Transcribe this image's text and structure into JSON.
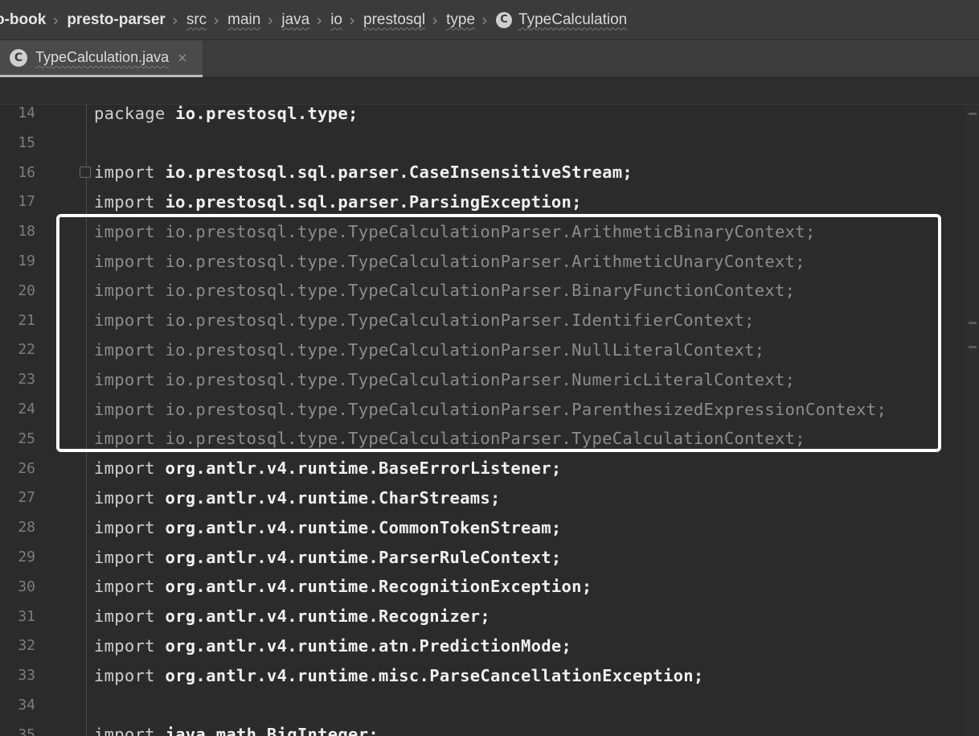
{
  "breadcrumb": {
    "items": [
      {
        "label": "o-book",
        "bold": true
      },
      {
        "label": "presto-parser",
        "bold": true
      },
      {
        "label": "src"
      },
      {
        "label": "main"
      },
      {
        "label": "java"
      },
      {
        "label": "io"
      },
      {
        "label": "prestosql"
      },
      {
        "label": "type"
      },
      {
        "label": "TypeCalculation",
        "icon": "class-icon"
      }
    ]
  },
  "tab": {
    "label": "TypeCalculation.java",
    "icon": "class-icon",
    "close_icon": "×"
  },
  "editor": {
    "lines": [
      {
        "num": "14",
        "kw": "package",
        "rest": " io.prestosql.type;",
        "unused": false
      },
      {
        "num": "15",
        "kw": "",
        "rest": "",
        "unused": false
      },
      {
        "num": "16",
        "kw": "import",
        "rest": " io.prestosql.sql.parser.CaseInsensitiveStream;",
        "unused": false,
        "fold": true
      },
      {
        "num": "17",
        "kw": "import",
        "rest": " io.prestosql.sql.parser.ParsingException;",
        "unused": false
      },
      {
        "num": "18",
        "kw": "import",
        "rest": " io.prestosql.type.TypeCalculationParser.ArithmeticBinaryContext;",
        "unused": true
      },
      {
        "num": "19",
        "kw": "import",
        "rest": " io.prestosql.type.TypeCalculationParser.ArithmeticUnaryContext;",
        "unused": true
      },
      {
        "num": "20",
        "kw": "import",
        "rest": " io.prestosql.type.TypeCalculationParser.BinaryFunctionContext;",
        "unused": true
      },
      {
        "num": "21",
        "kw": "import",
        "rest": " io.prestosql.type.TypeCalculationParser.IdentifierContext;",
        "unused": true
      },
      {
        "num": "22",
        "kw": "import",
        "rest": " io.prestosql.type.TypeCalculationParser.NullLiteralContext;",
        "unused": true
      },
      {
        "num": "23",
        "kw": "import",
        "rest": " io.prestosql.type.TypeCalculationParser.NumericLiteralContext;",
        "unused": true
      },
      {
        "num": "24",
        "kw": "import",
        "rest": " io.prestosql.type.TypeCalculationParser.ParenthesizedExpressionContext;",
        "unused": true
      },
      {
        "num": "25",
        "kw": "import",
        "rest": " io.prestosql.type.TypeCalculationParser.TypeCalculationContext;",
        "unused": true
      },
      {
        "num": "26",
        "kw": "import",
        "rest": " org.antlr.v4.runtime.BaseErrorListener;",
        "unused": false
      },
      {
        "num": "27",
        "kw": "import",
        "rest": " org.antlr.v4.runtime.CharStreams;",
        "unused": false
      },
      {
        "num": "28",
        "kw": "import",
        "rest": " org.antlr.v4.runtime.CommonTokenStream;",
        "unused": false
      },
      {
        "num": "29",
        "kw": "import",
        "rest": " org.antlr.v4.runtime.ParserRuleContext;",
        "unused": false
      },
      {
        "num": "30",
        "kw": "import",
        "rest": " org.antlr.v4.runtime.RecognitionException;",
        "unused": false
      },
      {
        "num": "31",
        "kw": "import",
        "rest": " org.antlr.v4.runtime.Recognizer;",
        "unused": false
      },
      {
        "num": "32",
        "kw": "import",
        "rest": " org.antlr.v4.runtime.atn.PredictionMode;",
        "unused": false
      },
      {
        "num": "33",
        "kw": "import",
        "rest": " org.antlr.v4.runtime.misc.ParseCancellationException;",
        "unused": false
      },
      {
        "num": "34",
        "kw": "",
        "rest": "",
        "unused": false
      },
      {
        "num": "35",
        "kw": "import",
        "rest": " java.math.BigInteger;",
        "unused": false
      }
    ]
  },
  "colors": {
    "background": "#2b2b2b",
    "highlight_box": "#ffffff",
    "unused_import": "#8c8c8c"
  }
}
